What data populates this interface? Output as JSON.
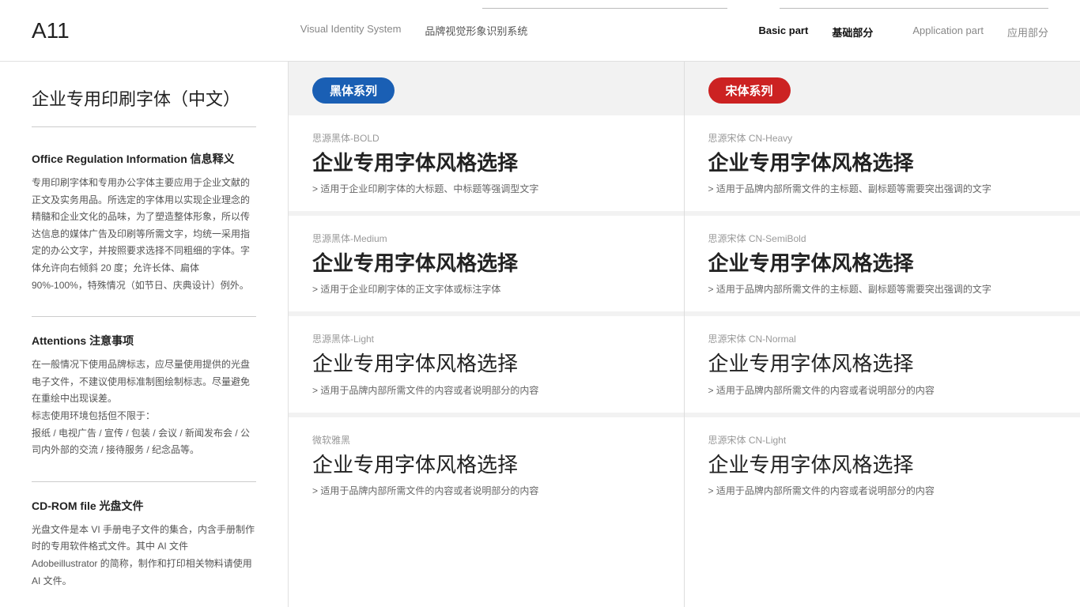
{
  "header": {
    "code": "A11",
    "nav_center_en": "Visual Identity System",
    "nav_center_cn": "品牌视觉形象识别系统",
    "nav_right_basic_label": "Basic part",
    "nav_right_basic_cn": "基础部分",
    "nav_right_app_label": "Application part",
    "nav_right_app_cn": "应用部分"
  },
  "sidebar": {
    "title": "企业专用印刷字体（中文）",
    "sections": [
      {
        "title": "Office Regulation Information 信息释义",
        "body": "专用印刷字体和专用办公字体主要应用于企业文献的正文及实务用品。所选定的字体用以实现企业理念的精髓和企业文化的品味，为了塑造整体形象，所以传达信息的媒体广告及印刷等所需文字，均统一采用指定的办公文字，并按照要求选择不同粗细的字体。字体允许向右倾斜 20 度；允许长体、扁体 90%-100%，特殊情况（如节日、庆典设计）例外。"
      },
      {
        "title": "Attentions 注意事项",
        "body": "在一般情况下使用品牌标志，应尽量使用提供的光盘电子文件，不建议使用标准制图绘制标志。尽量避免在重绘中出现误差。\n标志使用环境包括但不限于：\n报纸 / 电视广告 / 宣传 / 包装 / 会议 / 新闻发布会 / 公司内外部的交流 / 接待服务 / 纪念品等。"
      },
      {
        "title": "CD-ROM file 光盘文件",
        "body": "光盘文件是本 VI 手册电子文件的集合，内含手册制作时的专用软件格式文件。其中 AI 文件 Adobeillustrator 的简称，制作和打印相关物料请使用 AI 文件。"
      }
    ]
  },
  "left_column": {
    "badge": "黑体系列",
    "badge_color": "blue",
    "entries": [
      {
        "name": "思源黑体-BOLD",
        "demo": "企业专用字体风格选择",
        "weight": "w900",
        "desc": "> 适用于企业印刷字体的大标题、中标题等强调型文字"
      },
      {
        "name": "思源黑体-Medium",
        "demo": "企业专用字体风格选择",
        "weight": "w700",
        "desc": "> 适用于企业印刷字体的正文字体或标注字体"
      },
      {
        "name": "思源黑体-Light",
        "demo": "企业专用字体风格选择",
        "weight": "w400",
        "desc": "> 适用于品牌内部所需文件的内容或者说明部分的内容"
      },
      {
        "name": "微软雅黑",
        "demo": "企业专用字体风格选择",
        "weight": "w400",
        "desc": "> 适用于品牌内部所需文件的内容或者说明部分的内容"
      }
    ]
  },
  "right_column": {
    "badge": "宋体系列",
    "badge_color": "red",
    "entries": [
      {
        "name": "思源宋体 CN-Heavy",
        "demo": "企业专用字体风格选择",
        "weight": "w900",
        "desc": "> 适用于品牌内部所需文件的主标题、副标题等需要突出强调的文字"
      },
      {
        "name": "思源宋体 CN-SemiBold",
        "demo": "企业专用字体风格选择",
        "weight": "w700",
        "desc": "> 适用于品牌内部所需文件的主标题、副标题等需要突出强调的文字"
      },
      {
        "name": "思源宋体 CN-Normal",
        "demo": "企业专用字体风格选择",
        "weight": "w400",
        "desc": "> 适用于品牌内部所需文件的内容或者说明部分的内容"
      },
      {
        "name": "思源宋体 CN-Light",
        "demo": "企业专用字体风格选择",
        "weight": "w300",
        "desc": "> 适用于品牌内部所需文件的内容或者说明部分的内容"
      }
    ]
  }
}
